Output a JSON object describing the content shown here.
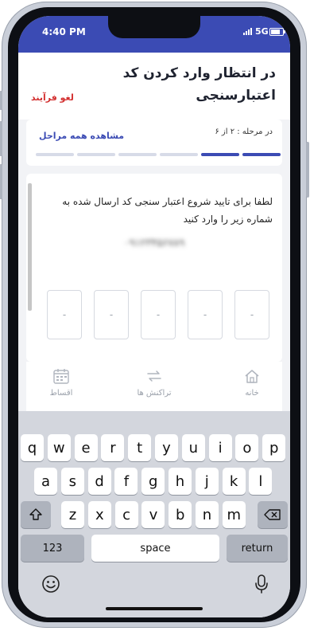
{
  "status_bar": {
    "time": "4:40 PM",
    "network": "5G"
  },
  "header": {
    "title": "در انتظار وارد کردن کد اعتبارسنجی",
    "cancel_label": "لغو فرآیند"
  },
  "steps": {
    "label": "در مرحله : ۲ از ۶",
    "view_all_label": "مشاهده همه مراحل",
    "current": 2,
    "total": 6
  },
  "otp": {
    "instruction": "لطفا برای تایید شروع اعتبار سنجی کد ارسال شده به شماره زیر را وارد کنید",
    "phone_number": "۰۹۱۲۳۴۵۶۷۸۹",
    "digits": [
      "-",
      "-",
      "-",
      "-",
      "-"
    ]
  },
  "nav": [
    {
      "label": "خانه",
      "icon": "home-icon"
    },
    {
      "label": "تراکنش ها",
      "icon": "transactions-icon"
    },
    {
      "label": "اقساط",
      "icon": "calendar-icon"
    }
  ],
  "keyboard": {
    "row1": [
      "q",
      "w",
      "e",
      "r",
      "t",
      "y",
      "u",
      "i",
      "o",
      "p"
    ],
    "row2": [
      "a",
      "s",
      "d",
      "f",
      "g",
      "h",
      "j",
      "k",
      "l"
    ],
    "row3": [
      "z",
      "x",
      "c",
      "v",
      "b",
      "n",
      "m"
    ],
    "numbers_label": "123",
    "space_label": "space",
    "return_label": "return"
  },
  "colors": {
    "primary": "#3b4bb4",
    "danger": "#d32f2f"
  }
}
